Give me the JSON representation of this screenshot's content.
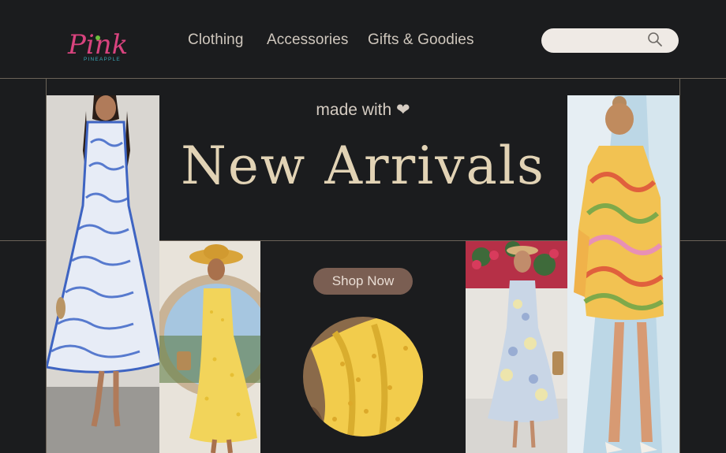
{
  "brand": {
    "name": "Pink",
    "tagline": "PINEAPPLE"
  },
  "nav": [
    {
      "label": "Clothing"
    },
    {
      "label": "Accessories"
    },
    {
      "label": "Gifts & Goodies"
    }
  ],
  "search": {
    "placeholder": "",
    "value": ""
  },
  "hero": {
    "kicker": "made with ❤",
    "title": "New Arrivals",
    "cta_label": "Shop Now"
  },
  "colors": {
    "background": "#1b1c1e",
    "title": "#e2d3b5",
    "cta": "#7a5e52",
    "search_bg": "#efeae5",
    "brand_pink": "#d8437e"
  },
  "icons": {
    "search": "magnifier-icon"
  }
}
